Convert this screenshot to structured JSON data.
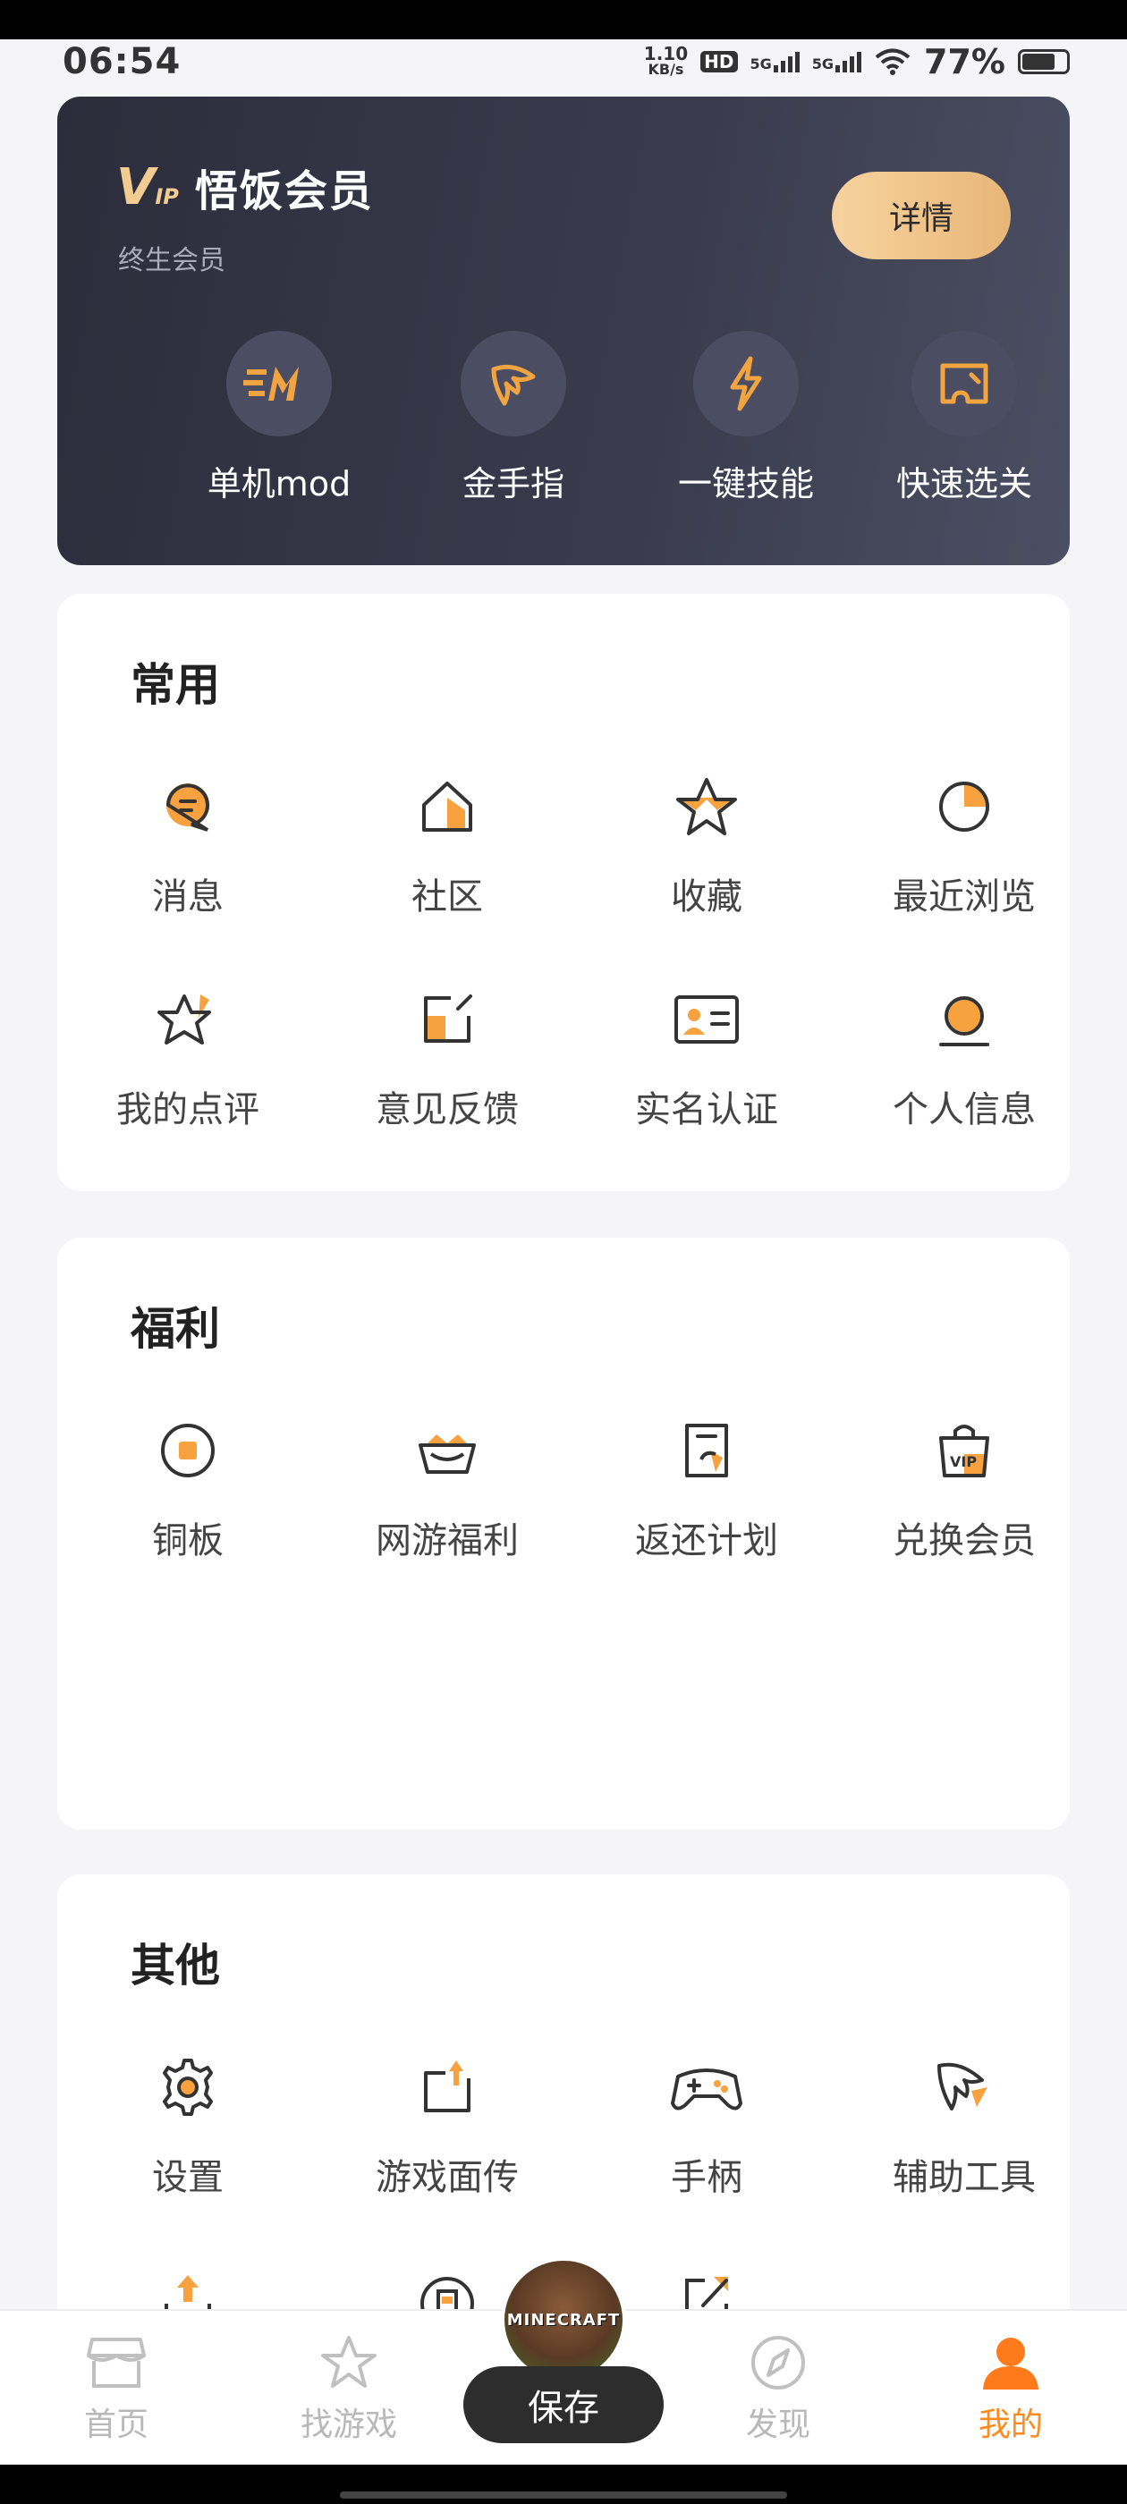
{
  "status": {
    "time": "06:54",
    "net_speed_value": "1.10",
    "net_speed_unit": "KB/s",
    "hd": "HD",
    "sim1": "5G",
    "sim2": "5G",
    "battery": "77%"
  },
  "vip": {
    "logo_mark": "V",
    "logo_sub": "IP",
    "title": "悟饭会员",
    "subtitle": "终生会员",
    "detail_button": "详情",
    "features": [
      {
        "label": "单机mod",
        "icon": "mod-icon"
      },
      {
        "label": "金手指",
        "icon": "wing-icon"
      },
      {
        "label": "一键技能",
        "icon": "lightning-icon"
      },
      {
        "label": "快速选关",
        "icon": "ticket-icon"
      }
    ]
  },
  "common": {
    "title": "常用",
    "items": [
      {
        "label": "消息",
        "icon": "message-icon"
      },
      {
        "label": "社区",
        "icon": "home-icon"
      },
      {
        "label": "收藏",
        "icon": "star-icon"
      },
      {
        "label": "最近浏览",
        "icon": "clock-pie-icon"
      },
      {
        "label": "我的点评",
        "icon": "review-star-icon"
      },
      {
        "label": "意见反馈",
        "icon": "feedback-icon"
      },
      {
        "label": "实名认证",
        "icon": "id-card-icon"
      },
      {
        "label": "个人信息",
        "icon": "profile-icon"
      }
    ]
  },
  "welfare": {
    "title": "福利",
    "items": [
      {
        "label": "铜板",
        "icon": "coin-icon"
      },
      {
        "label": "网游福利",
        "icon": "crown-box-icon"
      },
      {
        "label": "返还计划",
        "icon": "refund-icon"
      },
      {
        "label": "兑换会员",
        "icon": "vip-bag-icon"
      }
    ]
  },
  "others": {
    "title": "其他",
    "items": [
      {
        "label": "设置",
        "icon": "gear-icon"
      },
      {
        "label": "游戏面传",
        "icon": "upload-box-icon"
      },
      {
        "label": "手柄",
        "icon": "gamepad-icon"
      },
      {
        "label": "辅助工具",
        "icon": "tool-wing-icon"
      }
    ]
  },
  "nav": {
    "items": [
      {
        "label": "首页",
        "icon": "store-icon"
      },
      {
        "label": "找游戏",
        "icon": "star-outline-icon"
      },
      {
        "label": "发现",
        "icon": "compass-icon"
      },
      {
        "label": "我的",
        "icon": "user-icon"
      }
    ],
    "center_game_text": "MINECRAFT",
    "save_label": "保存"
  },
  "colors": {
    "accent": "#ff8a1f",
    "vip_gold": "#f3cc92",
    "vip_card": "#2c2d3b"
  }
}
